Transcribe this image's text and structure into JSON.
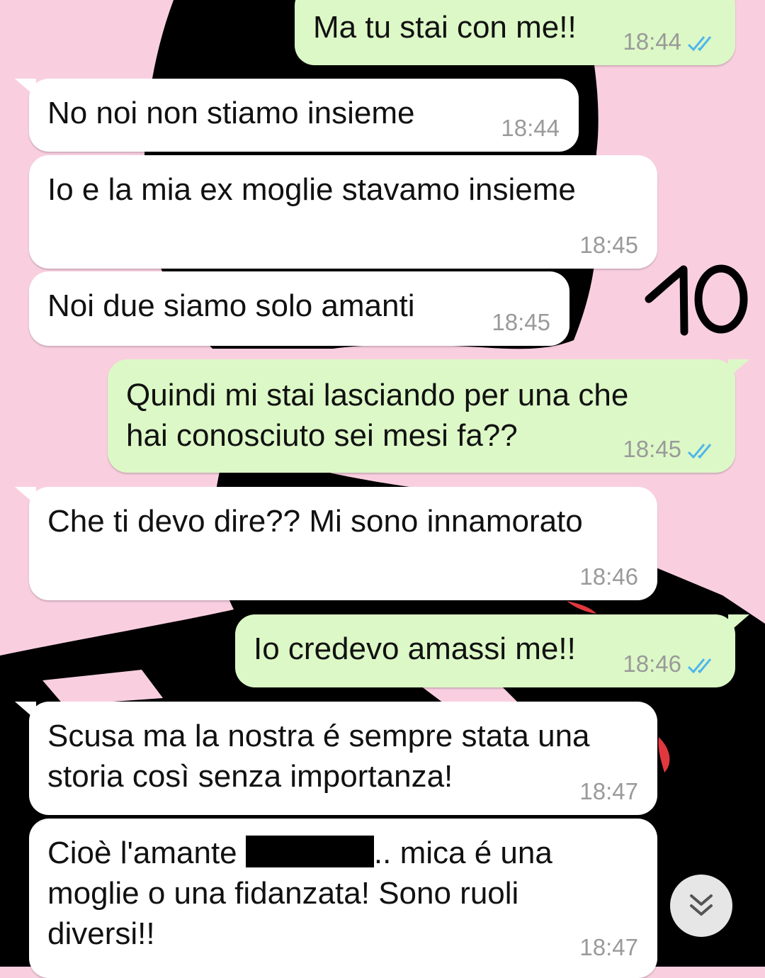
{
  "chat": {
    "messages": [
      {
        "direction": "outgoing",
        "text": "Ma tu stai con me!!",
        "time": "18:44",
        "status": "read"
      },
      {
        "direction": "incoming",
        "text": "No noi non stiamo insieme",
        "time": "18:44"
      },
      {
        "direction": "incoming",
        "text": "Io e la mia ex moglie stavamo insieme",
        "time": "18:45"
      },
      {
        "direction": "incoming",
        "text": "Noi due siamo solo amanti",
        "time": "18:45"
      },
      {
        "direction": "outgoing",
        "lines": [
          "Quindi mi stai lasciando per una che",
          "hai conosciuto sei mesi fa??"
        ],
        "time": "18:45",
        "status": "read"
      },
      {
        "direction": "incoming",
        "text": "Che ti devo dire?? Mi sono innamorato",
        "time": "18:46"
      },
      {
        "direction": "outgoing",
        "text": "Io credevo amassi me!!",
        "time": "18:46",
        "status": "read"
      },
      {
        "direction": "incoming",
        "lines": [
          "Scusa ma la nostra é sempre stata una",
          "storia così senza importanza!"
        ],
        "time": "18:47"
      },
      {
        "direction": "incoming",
        "lines": [
          "Cioè l'amante",
          ".. mica é una",
          "moglie o una fidanzata! Sono ruoli",
          "diversi!!"
        ],
        "time": "18:47"
      }
    ]
  },
  "overlay_number": "10",
  "scroll_button": {
    "icon": "double-chevron-down-icon"
  },
  "colors": {
    "incoming_bubble": "#ffffff",
    "outgoing_bubble": "#dcf8c6",
    "read_ticks": "#4fb6ec",
    "wallpaper_pink": "#f9cfe0",
    "wallpaper_black": "#000000"
  }
}
